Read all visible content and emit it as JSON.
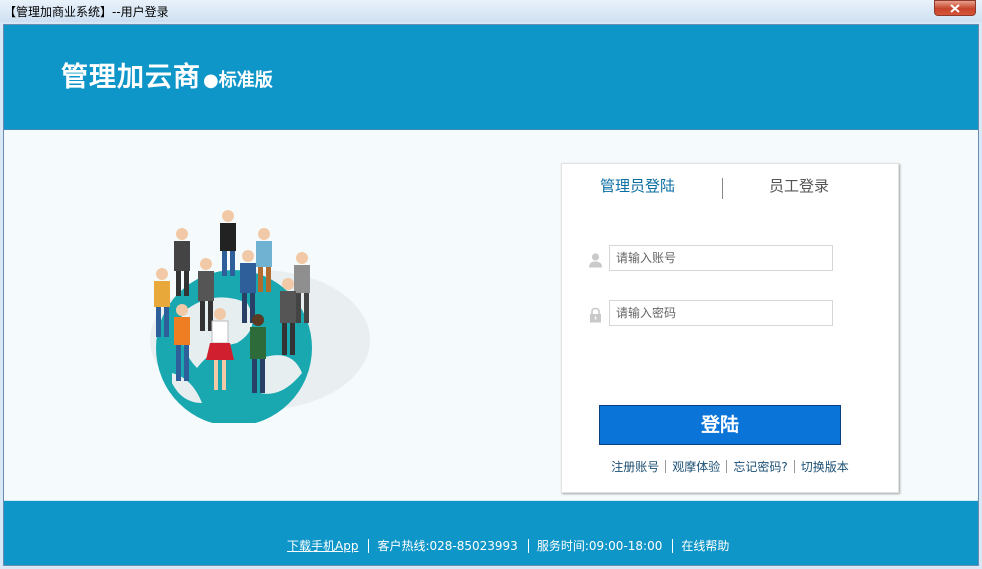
{
  "window": {
    "title": "【管理加商业系统】--用户登录"
  },
  "header": {
    "brand": "管理加云商",
    "dot": "●",
    "edition": "标准版"
  },
  "login": {
    "tabs": [
      {
        "label": "管理员登陆"
      },
      {
        "label": "员工登录"
      }
    ],
    "account_placeholder": "请输入账号",
    "password_placeholder": "请输入密码",
    "login_button": "登陆",
    "links": [
      "注册账号",
      "观摩体验",
      "忘记密码?",
      "切换版本"
    ]
  },
  "footer": {
    "app_link": "下载手机App",
    "hotline": "客户热线:028-85023993",
    "service_hours": "服务时间:09:00-18:00",
    "help": "在线帮助"
  },
  "colors": {
    "header_bg": "#0f96c9",
    "button_bg": "#0a74d9",
    "active_tab": "#0a6ea3"
  }
}
